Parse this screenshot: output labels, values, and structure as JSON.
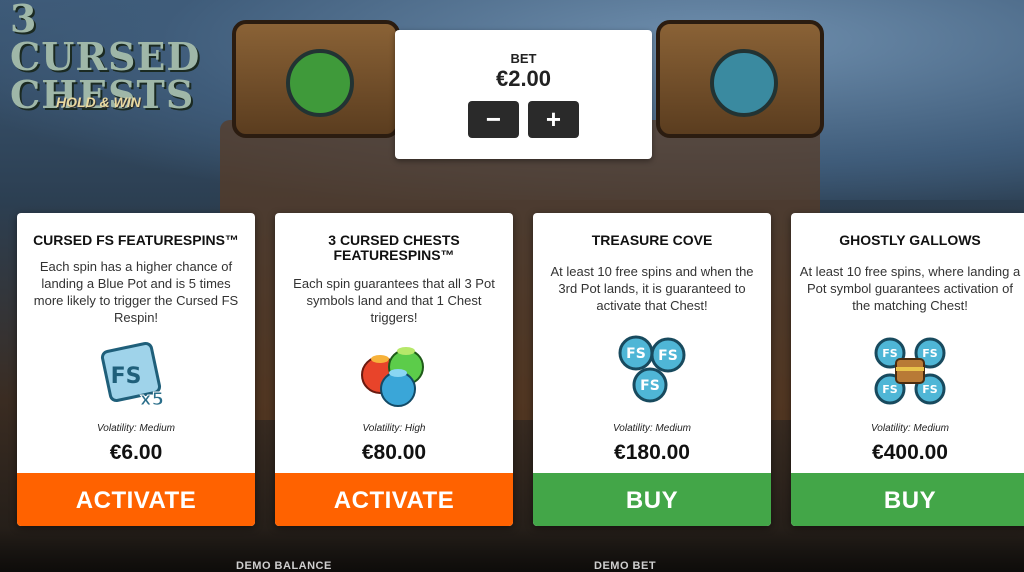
{
  "game": {
    "logo_title": "3 CURSED CHESTS",
    "logo_subtitle": "HOLD & WIN"
  },
  "bet": {
    "label": "BET",
    "value": "€2.00",
    "minus_label": "−",
    "plus_label": "+"
  },
  "cards": [
    {
      "title": "CURSED FS FEATURESPINS™",
      "description": "Each spin has a higher chance of landing a Blue Pot and is 5 times more likely to trigger the Cursed FS Respin!",
      "icon": "fs-x5-icon",
      "volatility": "Volatility: Medium",
      "price": "€6.00",
      "button_label": "ACTIVATE",
      "button_color": "#ff6200"
    },
    {
      "title": "3 CURSED CHESTS FEATURESPINS™",
      "description": "Each spin guarantees that all 3 Pot symbols land and that 1 Chest triggers!",
      "icon": "three-pots-icon",
      "volatility": "Volatility: High",
      "price": "€80.00",
      "button_label": "ACTIVATE",
      "button_color": "#ff6200"
    },
    {
      "title": "TREASURE COVE",
      "description": "At least 10 free spins and when the 3rd Pot lands, it is guaranteed to activate that Chest!",
      "icon": "fs-triple-icon",
      "volatility": "Volatility: Medium",
      "price": "€180.00",
      "button_label": "BUY",
      "button_color": "#43a648"
    },
    {
      "title": "GHOSTLY GALLOWS",
      "description": "At least 10 free spins, where landing a Pot symbol guarantees activation of the matching Chest!",
      "icon": "fs-chest-icon",
      "volatility": "Volatility: Medium",
      "price": "€400.00",
      "button_label": "BUY",
      "button_color": "#43a648"
    }
  ],
  "bottom_bar": {
    "demo_balance_label": "DEMO BALANCE",
    "demo_bet_label": "DEMO BET"
  }
}
